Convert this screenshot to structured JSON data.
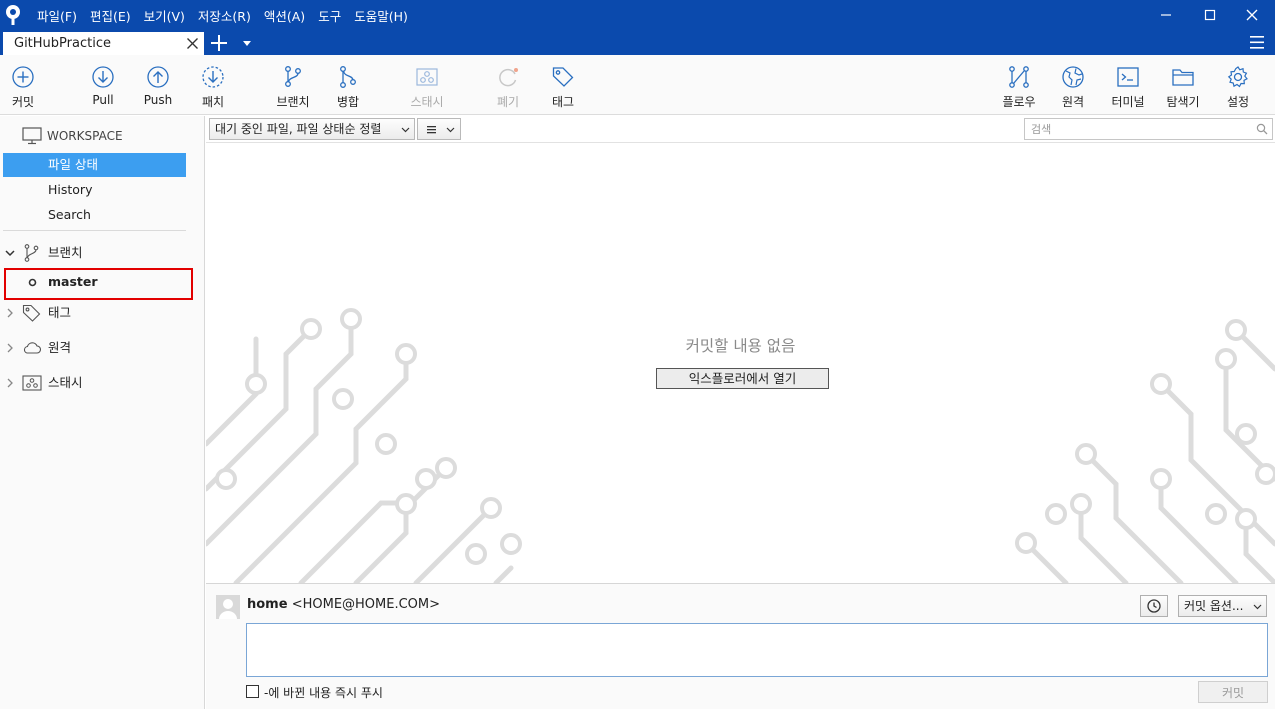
{
  "menu": {
    "items": [
      "파일(F)",
      "편집(E)",
      "보기(V)",
      "저장소(R)",
      "액션(A)",
      "도구",
      "도움말(H)"
    ]
  },
  "window": {
    "minimize_icon": "minimize-icon",
    "maximize_icon": "maximize-icon",
    "close_icon": "close-icon"
  },
  "tabs": {
    "active_tab": "GitHubPractice",
    "add_icon": "plus-icon",
    "dropdown_icon": "caret-down-icon",
    "menu_icon": "hamburger-icon"
  },
  "toolbar": {
    "commit": "커밋",
    "pull": "Pull",
    "push": "Push",
    "fetch": "패치",
    "branch": "브랜치",
    "merge": "병합",
    "stash": "스태시",
    "discard": "폐기",
    "tag": "태그",
    "flow": "플로우",
    "remote": "원격",
    "terminal": "터미널",
    "explorer": "탐색기",
    "settings": "설정"
  },
  "sidebar": {
    "workspace": "WORKSPACE",
    "file_status": "파일 상태",
    "history": "History",
    "search": "Search",
    "branches": "브랜치",
    "current_branch": "master",
    "tags": "태그",
    "remotes": "원격",
    "stashes": "스태시"
  },
  "filterbar": {
    "file_filter": "대기 중인 파일, 파일 상태순 정렬",
    "search_placeholder": "검색"
  },
  "content": {
    "empty_message": "커밋할 내용 없음",
    "open_explorer": "익스플로러에서 열기"
  },
  "commit": {
    "author_name": "home",
    "author_email": "<HOME@HOME.COM>",
    "options_label": "커밋 옵션...",
    "message_value": "",
    "push_label": "-에 바뀐 내용 즉시 푸시",
    "push_checked": false,
    "commit_button": "커밋"
  },
  "colors": {
    "titlebar": "#0b4aad",
    "selection": "#3c9ef0",
    "highlight_box": "#e20000",
    "icon_blue": "#2a6fc0"
  }
}
